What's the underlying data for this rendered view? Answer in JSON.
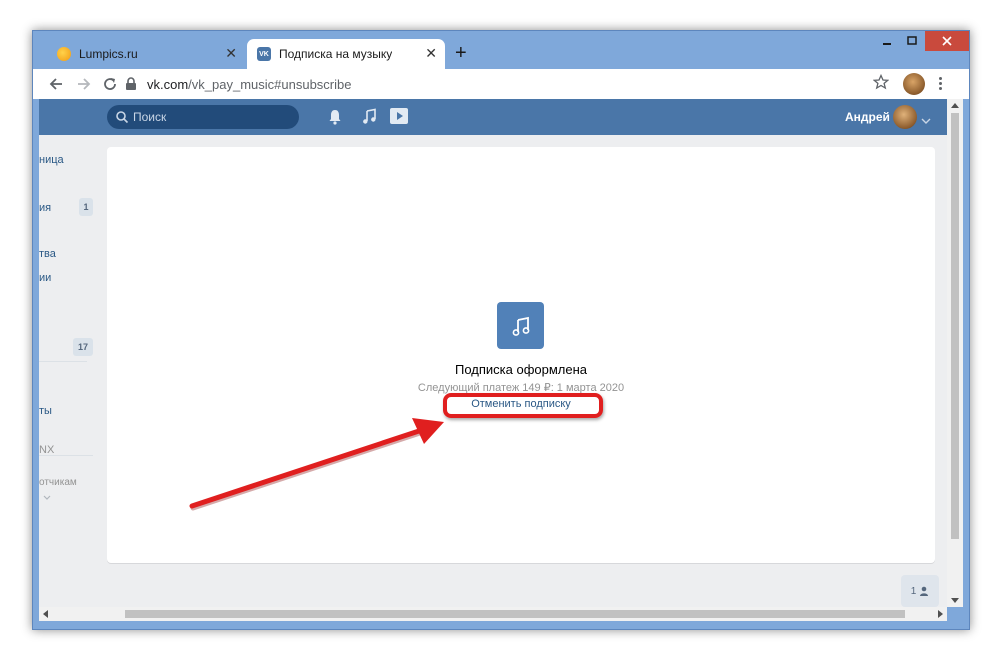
{
  "browser": {
    "tabs": [
      {
        "title": "Lumpics.ru",
        "favicon": "orange-circle-icon"
      },
      {
        "title": "Подписка на музыку",
        "favicon": "vk-icon"
      }
    ],
    "new_tab_symbol": "+",
    "close_symbol": "✕",
    "address": {
      "host": "vk.com",
      "path": "/vk_pay_music#unsubscribe"
    }
  },
  "vk_header": {
    "search_placeholder": "Поиск",
    "user_name": "Андрей"
  },
  "left_menu": {
    "items": [
      {
        "label": "ница"
      },
      {
        "label": "ия",
        "badge": "1"
      },
      {
        "label": "тва"
      },
      {
        "label": "ии"
      },
      {
        "label": "",
        "badge": "17"
      },
      {
        "label": "ты"
      },
      {
        "label": "NX"
      },
      {
        "label": "отчикам"
      }
    ]
  },
  "subscription": {
    "title": "Подписка оформлена",
    "next_payment": "Следующий платеж 149 ₽: 1 марта 2020",
    "cancel_link": "Отменить подписку"
  },
  "online_widget": {
    "count": "1"
  },
  "colors": {
    "vk_blue": "#4a76a8",
    "link": "#2a5885",
    "annotation_red": "#e01f1f"
  }
}
